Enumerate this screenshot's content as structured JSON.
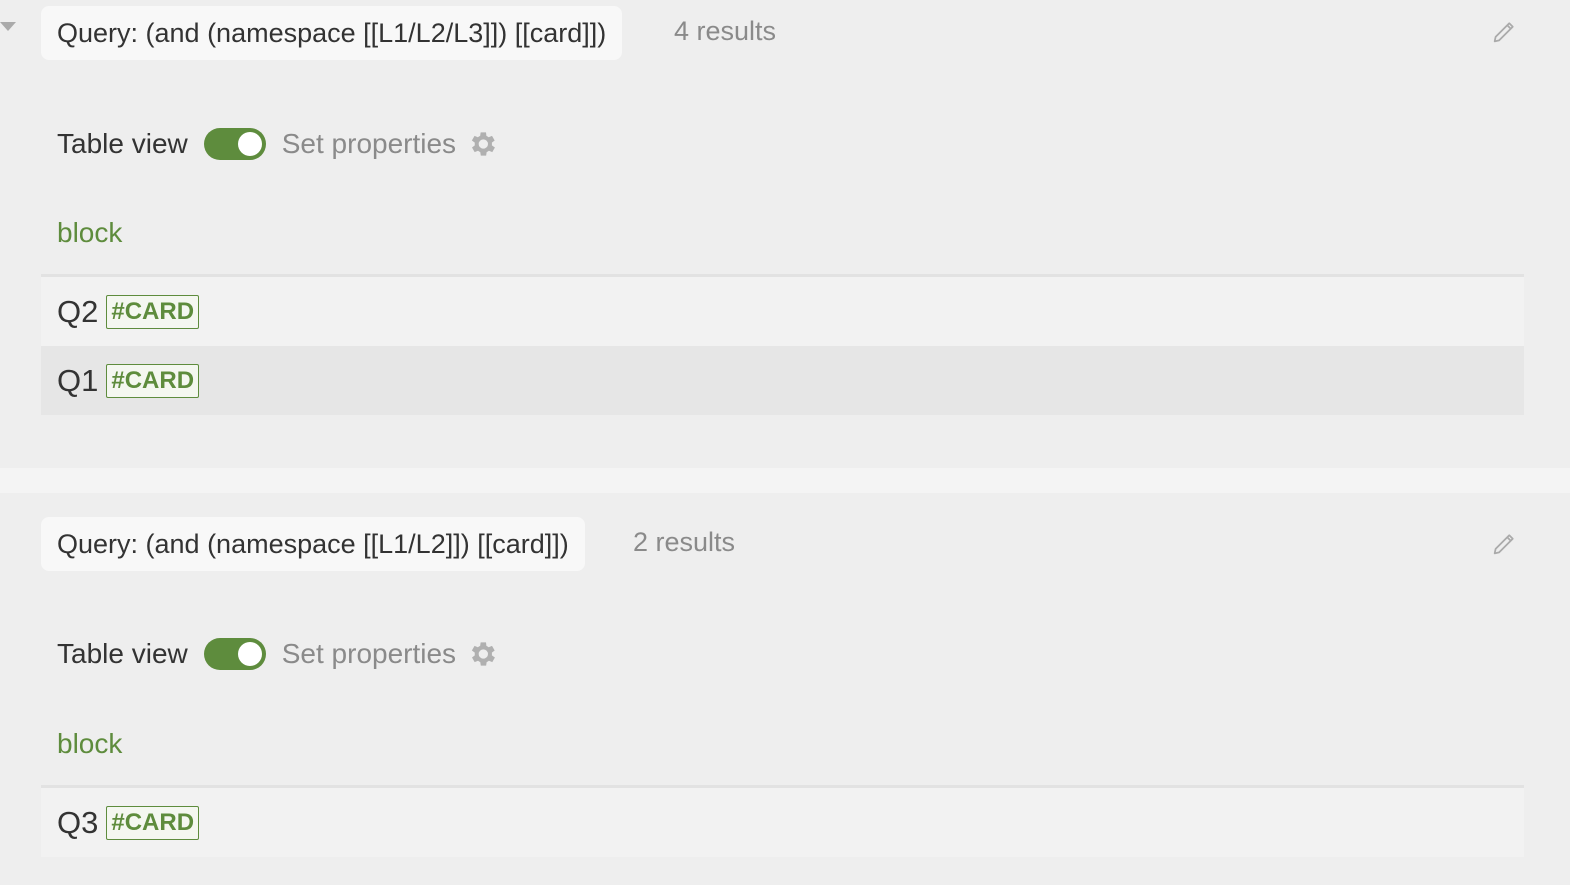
{
  "queries": [
    {
      "title": "Query: (and (namespace [[L1/L2/L3]]) [[card]])",
      "results": "4 results",
      "table_view_label": "Table view",
      "set_properties_label": "Set properties",
      "column_header": "block",
      "rows": [
        {
          "title": "Q2",
          "tag": "#CARD"
        },
        {
          "title": "Q1",
          "tag": "#CARD"
        }
      ]
    },
    {
      "title": "Query: (and (namespace [[L1/L2]]) [[card]])",
      "results": "2 results",
      "table_view_label": "Table view",
      "set_properties_label": "Set properties",
      "column_header": "block",
      "rows": [
        {
          "title": "Q3",
          "tag": "#CARD"
        }
      ]
    }
  ],
  "colors": {
    "accent": "#5e8c3d",
    "muted_text": "#8a8a8a",
    "block_bg": "#eeeeee"
  },
  "icons": {
    "edit": "pencil-icon",
    "settings": "gear-icon",
    "collapse": "triangle-down-icon"
  }
}
